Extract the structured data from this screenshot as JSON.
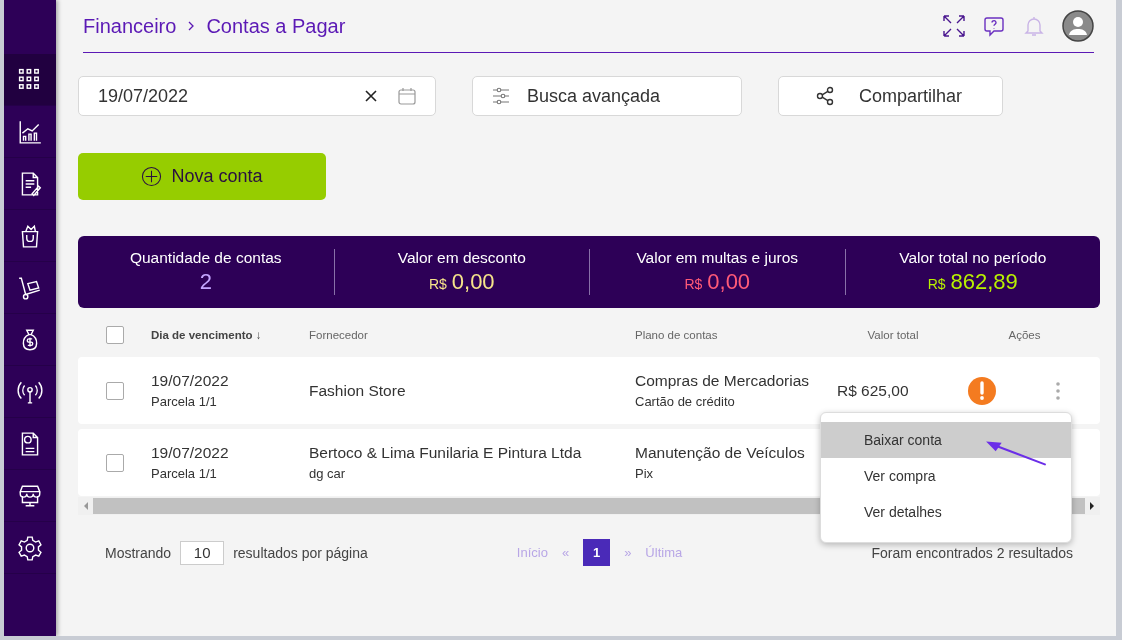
{
  "sidebar": {
    "items": [
      {
        "kind": "grid",
        "selected": true
      },
      {
        "kind": "chart",
        "selected": false
      },
      {
        "kind": "document",
        "selected": false
      },
      {
        "kind": "bag",
        "selected": false
      },
      {
        "kind": "cart",
        "selected": false
      },
      {
        "kind": "money",
        "selected": false
      },
      {
        "kind": "antenna",
        "selected": false
      },
      {
        "kind": "report",
        "selected": false
      },
      {
        "kind": "store",
        "selected": false
      },
      {
        "kind": "gear",
        "selected": false
      }
    ]
  },
  "breadcrumb": [
    "Financeiro",
    "Contas a Pagar"
  ],
  "filters": {
    "date": "19/07/2022",
    "advanced_search": "Busca avançada",
    "share": "Compartilhar"
  },
  "new_button": "Nova conta",
  "summary": [
    {
      "label": "Quantidade de contas",
      "value": "2",
      "color": "#c4a4ff"
    },
    {
      "label": "Valor em desconto",
      "currency": "R$",
      "value": "0,00",
      "color": "#f6e48a"
    },
    {
      "label": "Valor em multas e juros",
      "currency": "R$",
      "value": "0,00",
      "color": "#ff5a78"
    },
    {
      "label": "Valor total no período",
      "currency": "R$",
      "value": "862,89",
      "color": "#b8f000"
    }
  ],
  "table": {
    "select_all_checked": false,
    "columns": [
      "Dia de vencimento",
      "Fornecedor",
      "Plano de contas",
      "Valor total",
      "Ações"
    ],
    "sort_indicator": "↓",
    "rows": [
      {
        "checked": false,
        "date": "19/07/2022",
        "installment": "Parcela 1/1",
        "supplier": "Fashion Store",
        "plan": "Compras de Mercadorias",
        "payment": "Cartão de crédito",
        "value": "R$ 625,00",
        "alert": true
      },
      {
        "checked": false,
        "date": "19/07/2022",
        "installment": "Parcela 1/1",
        "supplier": "Bertoco & Lima Funilaria E Pintura Ltda",
        "supplier_note": "dg car",
        "plan": "Manutenção de Veículos",
        "payment": "Pix"
      }
    ]
  },
  "menu": {
    "items": [
      {
        "label": "Baixar conta",
        "selected": true
      },
      {
        "label": "Ver compra",
        "selected": false
      },
      {
        "label": "Ver detalhes",
        "selected": false
      }
    ]
  },
  "pagination": {
    "per_page_label": "Mostrando",
    "per_page": "10",
    "per_page_suffix": "resultados por página",
    "links": [
      {
        "label": "Início",
        "kind": "text"
      },
      {
        "label": "«",
        "kind": "text"
      },
      {
        "label": "1",
        "kind": "page",
        "selected": true
      },
      {
        "label": "»",
        "kind": "text"
      },
      {
        "label": "Última",
        "kind": "text"
      }
    ],
    "results": "Foram encontrados 2 resultados"
  }
}
